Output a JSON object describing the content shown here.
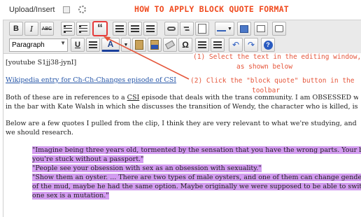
{
  "header": {
    "upload_label": "Upload/Insert",
    "headline": "HOW TO APPLY BLOCK QUOTE FORMAT"
  },
  "toolbar": {
    "row1": {
      "bold": "B",
      "italic": "I",
      "strike": "ABC",
      "blockquote": "“"
    },
    "row2": {
      "format_select": "Paragraph",
      "underline": "U",
      "color": "A",
      "omega": "Ω",
      "help": "?"
    }
  },
  "content": {
    "shortcode": "[youtube S1jj38-jynI]",
    "link_text": "Wikipedia entry for Ch-Ch-Changes episode of CSI",
    "para1_line1_a": "Both of these are in references to a ",
    "para1_line1_csi": "CSI",
    "para1_line1_b": " episode that deals with the trans community. I am OBSESSED with thi",
    "para1_line2": "in the bar with Kate Walsh in which she discusses the transition of Wendy, the character who is killed, is intere",
    "para2_line1": "Below are a few quotes I pulled from the clip, I think they are very relevant to what we're studying, and will he",
    "para2_line2": "we should research.",
    "quotes": [
      "\"Imagine being three years old, tormented by the sensation that you have the wrong parts. Your body is",
      "you're stuck without a passport.\"",
      "\"People see your obsession with sex as an obsession with sexuality.\"",
      "\"Show them an oyster. ... There are two types of male oysters, and one of them can change genders at w",
      "of the mud, maybe he had the same option. Maybe originally we were supposed to be able to switch gen",
      "one sex is a mutation.\""
    ]
  },
  "annotation": {
    "step1_line1": "(1)  Select the text in the editing window,",
    "step1_line2": "as shown below",
    "step2_line1": "(2)  Click the \"block quote\" button in the",
    "step2_line2": "toolbar",
    "color": "#e5553a"
  }
}
